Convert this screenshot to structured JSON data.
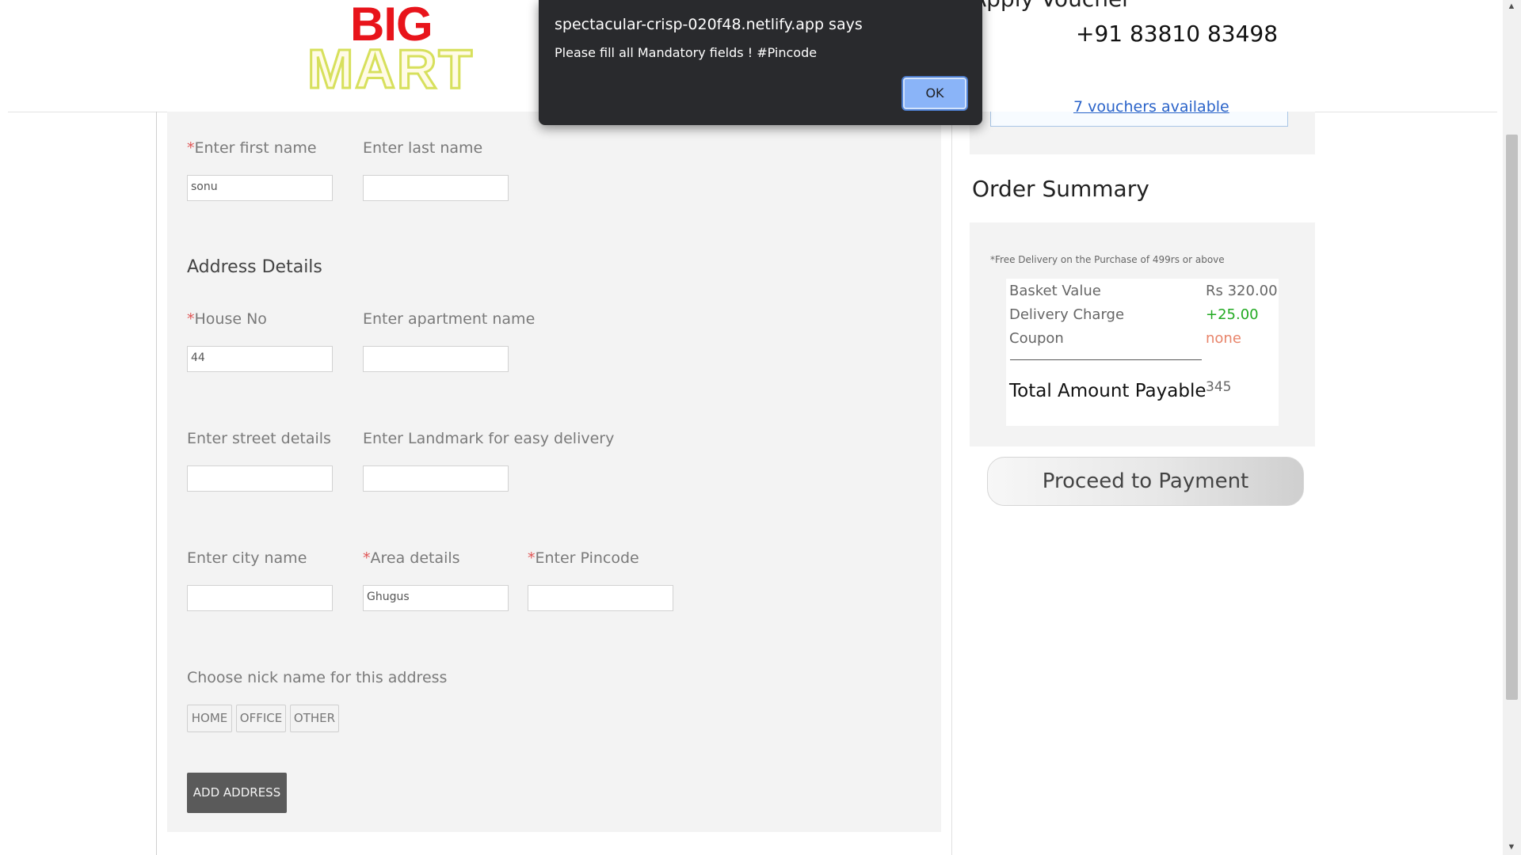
{
  "header": {
    "logo_big": "BIG",
    "logo_mart": "MART",
    "voucher_title": "Apply Voucher",
    "phone": "+91 83810 83498"
  },
  "form": {
    "first_name_label": "Enter first name",
    "first_name_value": "sonu",
    "last_name_label": "Enter last name",
    "last_name_value": "",
    "address_heading": "Address Details",
    "house_no_label": "House No",
    "house_no_value": "44",
    "apartment_label": "Enter apartment name",
    "apartment_value": "",
    "street_label": "Enter street details",
    "street_value": "",
    "landmark_label": "Enter Landmark for easy delivery",
    "landmark_value": "",
    "city_label": "Enter city name",
    "city_value": "",
    "area_label": "Area details",
    "area_value": "Ghugus",
    "pincode_label": "Enter Pincode",
    "pincode_value": "",
    "required_mark": "*",
    "nickname_label": "Choose nick name for this address",
    "nicknames": [
      "HOME",
      "OFFICE",
      "OTHER"
    ],
    "add_address_label": "ADD ADDRESS"
  },
  "vouchers": {
    "link_label": "7 vouchers available"
  },
  "summary": {
    "title": "Order Summary",
    "free_note": "*Free Delivery on the Purchase of 499rs or above",
    "basket_label": "Basket Value",
    "basket_value": "Rs 320.00",
    "delivery_label": "Delivery Charge",
    "delivery_value": "+25.00",
    "coupon_label": "Coupon",
    "coupon_value": "none",
    "total_label": "Total Amount Payable",
    "total_value": "345",
    "pay_button": "Proceed to Payment",
    "colors": {
      "delivery": "#22aa22",
      "coupon": "#e8846a"
    }
  },
  "dialog": {
    "title": "spectacular-crisp-020f48.netlify.app says",
    "message": "Please fill all Mandatory fields ! #Pincode",
    "ok_label": "OK"
  },
  "scrollbar": {
    "up_icon": "scroll-up-arrow-icon",
    "down_icon": "scroll-down-arrow-icon"
  }
}
